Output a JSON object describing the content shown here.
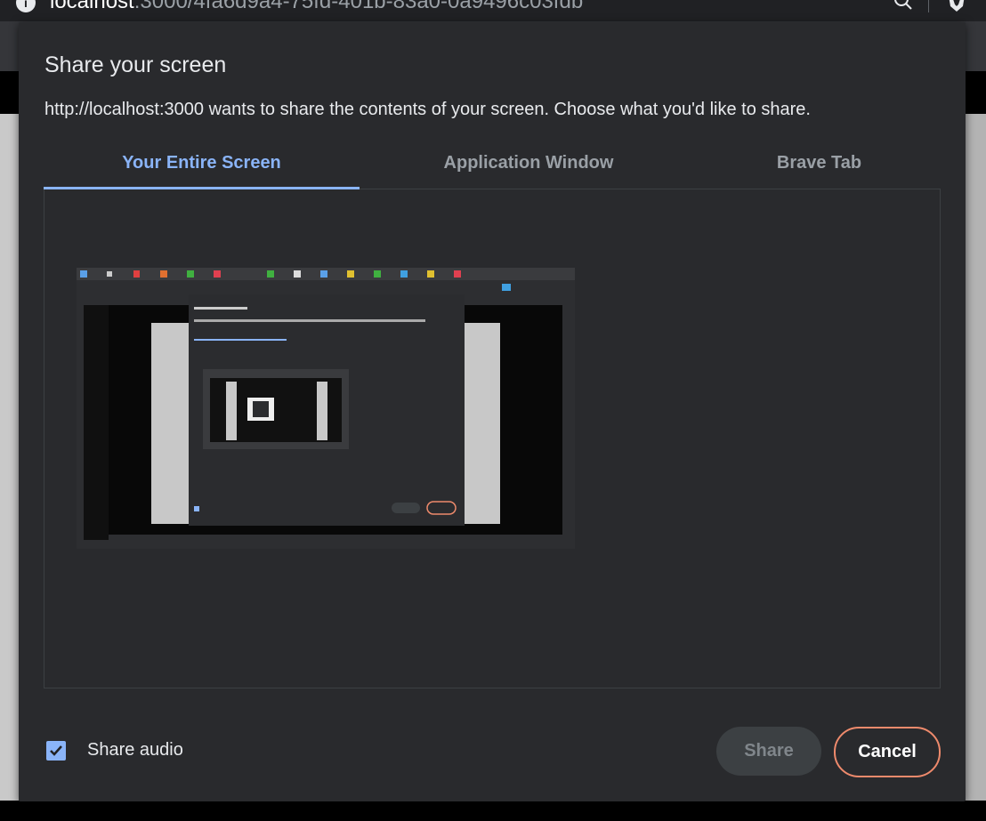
{
  "browser": {
    "url_host": "localhost",
    "url_rest": ":3000/4fa6d9a4-75fd-401b-83a0-0a9496c03fdb",
    "info_icon": "info-icon",
    "search_icon": "search-icon",
    "brave_icon": "brave-shield-icon"
  },
  "dialog": {
    "title": "Share your screen",
    "subtitle": "http://localhost:3000 wants to share the contents of your screen. Choose what you'd like to share.",
    "tabs": [
      {
        "label": "Your Entire Screen",
        "active": true
      },
      {
        "label": "Application Window",
        "active": false
      },
      {
        "label": "Brave Tab",
        "active": false
      }
    ],
    "share_audio_label": "Share audio",
    "share_audio_checked": true,
    "share_button": "Share",
    "cancel_button": "Cancel"
  },
  "colors": {
    "accent": "#8ab4f8",
    "dialog_bg": "#292a2d",
    "cancel_border": "#ee8a6c"
  }
}
